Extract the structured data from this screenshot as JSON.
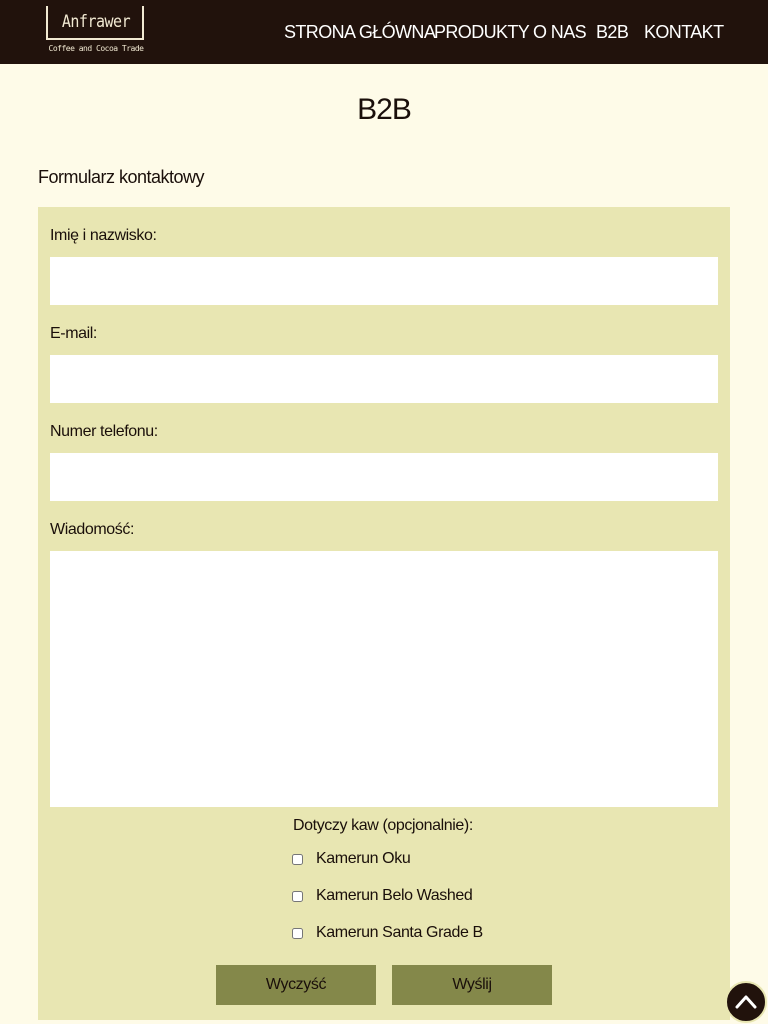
{
  "header": {
    "logo_name": "Anfrawer",
    "logo_tagline": "Coffee and Cocoa Trade",
    "nav": [
      {
        "label": "STRONA GŁÓWNA"
      },
      {
        "label": "PRODUKTY"
      },
      {
        "label": "O NAS"
      },
      {
        "label": "B2B"
      },
      {
        "label": "KONTAKT"
      }
    ]
  },
  "page": {
    "title": "B2B",
    "section_title": "Formularz kontaktowy"
  },
  "form": {
    "name_label": "Imię i nazwisko:",
    "name_value": "",
    "email_label": "E-mail:",
    "email_value": "",
    "phone_label": "Numer telefonu:",
    "phone_value": "",
    "message_label": "Wiadomość:",
    "message_value": "",
    "coffees_label": "Dotyczy kaw (opcjonalnie):",
    "coffees": [
      {
        "label": "Kamerun Oku",
        "checked": false
      },
      {
        "label": "Kamerun Belo Washed",
        "checked": false
      },
      {
        "label": "Kamerun Santa Grade B",
        "checked": false
      }
    ],
    "clear_label": "Wyczyść",
    "send_label": "Wyślij"
  },
  "scroll_top": {
    "icon": "chevron-up-icon"
  },
  "colors": {
    "header_bg": "#21120c",
    "page_bg": "#fefbe8",
    "panel_bg": "#e8e6b2",
    "button_bg": "#84884a"
  }
}
